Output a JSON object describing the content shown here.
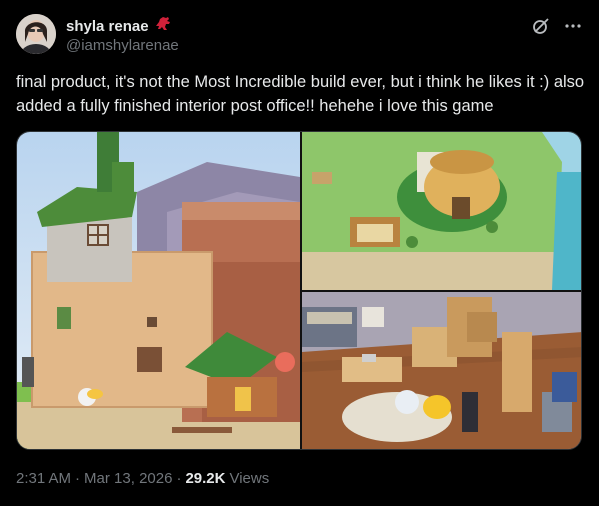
{
  "author": {
    "display_name": "shyla renae",
    "handle": "@iamshylarenae",
    "badge_icon": "red-dinosaur-icon"
  },
  "header_icons": [
    "grok-icon",
    "more-options-icon"
  ],
  "post": {
    "text": "final product, it's not the Most Incredible build ever, but i think he likes it :) also added a fully finished interior post office!! hehehe i love this game"
  },
  "media": [
    {
      "name": "voxel-house-screenshot"
    },
    {
      "name": "map-island-screenshot"
    },
    {
      "name": "post-office-interior-screenshot"
    }
  ],
  "meta": {
    "time": "2:31 AM",
    "separator": "·",
    "date": "Mar 13, 2026",
    "views_count": "29.2K",
    "views_label": "Views"
  },
  "colors": {
    "background": "#000000",
    "text_primary": "#e7e9ea",
    "text_secondary": "#71767b",
    "badge": "#d0213a"
  }
}
